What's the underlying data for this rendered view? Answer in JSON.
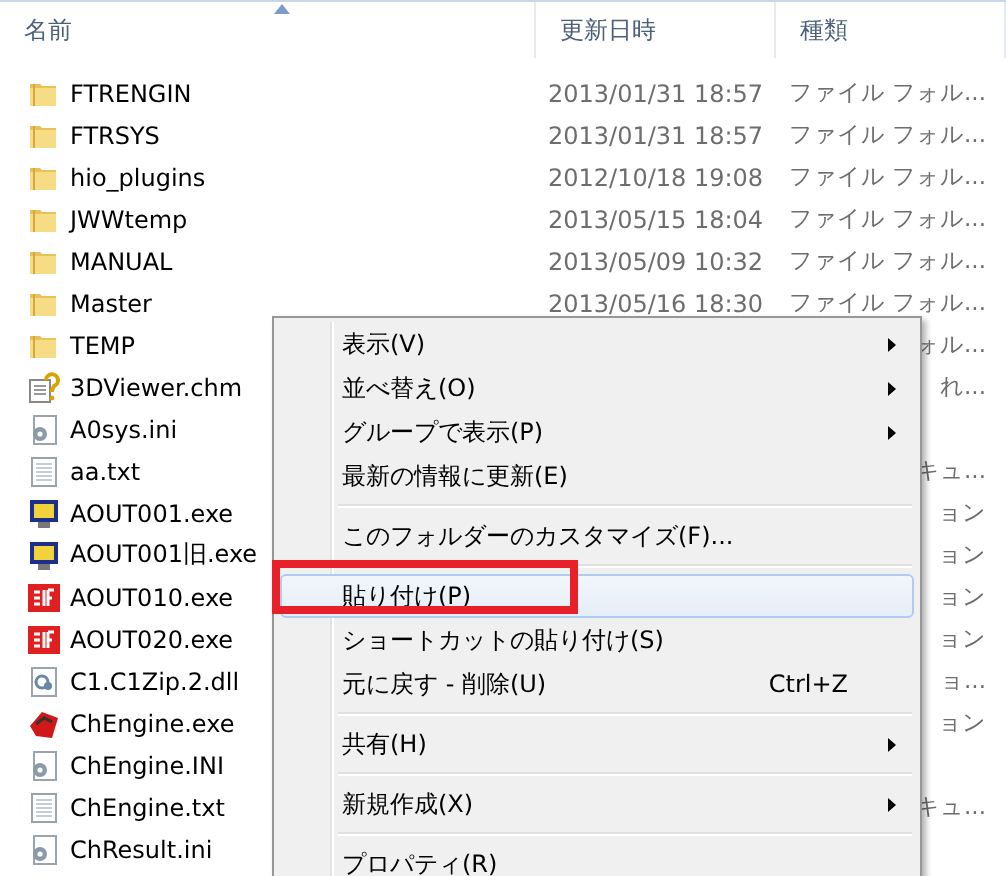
{
  "columns": [
    {
      "label": "名前",
      "sorted": true
    },
    {
      "label": "更新日時",
      "sorted": false
    },
    {
      "label": "種類",
      "sorted": false
    }
  ],
  "files": [
    {
      "name": "FTRENGIN",
      "kind": "folder",
      "date": "2013/01/31 18:57",
      "type": "ファイル フォル..."
    },
    {
      "name": "FTRSYS",
      "kind": "folder",
      "date": "2013/01/31 18:57",
      "type": "ファイル フォル..."
    },
    {
      "name": "hio_plugins",
      "kind": "folder",
      "date": "2012/10/18 19:08",
      "type": "ファイル フォル..."
    },
    {
      "name": "JWWtemp",
      "kind": "folder",
      "date": "2013/05/15 18:04",
      "type": "ファイル フォル..."
    },
    {
      "name": "MANUAL",
      "kind": "folder",
      "date": "2013/05/09 10:32",
      "type": "ファイル フォル..."
    },
    {
      "name": "Master",
      "kind": "folder",
      "date": "2013/05/16 18:30",
      "type": "ファイル フォル..."
    },
    {
      "name": "TEMP",
      "kind": "folder",
      "type": "ォル..."
    },
    {
      "name": "3DViewer.chm",
      "kind": "help",
      "type": "れ..."
    },
    {
      "name": "A0sys.ini",
      "kind": "settings"
    },
    {
      "name": "aa.txt",
      "kind": "text",
      "type": "キュ..."
    },
    {
      "name": "AOUT001.exe",
      "kind": "app",
      "type": "ョン"
    },
    {
      "name": "AOUT001旧.exe",
      "kind": "app",
      "type": "ョン"
    },
    {
      "name": "AOUT010.exe",
      "kind": "sif",
      "type": "ョン"
    },
    {
      "name": "AOUT020.exe",
      "kind": "sif",
      "type": "ョン"
    },
    {
      "name": "C1.C1Zip.2.dll",
      "kind": "library",
      "type": "ョ..."
    },
    {
      "name": "ChEngine.exe",
      "kind": "engine",
      "type": "ョン"
    },
    {
      "name": "ChEngine.INI",
      "kind": "settings"
    },
    {
      "name": "ChEngine.txt",
      "kind": "text",
      "type": "キュ..."
    },
    {
      "name": "ChResult.ini",
      "kind": "settings"
    }
  ],
  "context_menu": [
    {
      "kind": "item",
      "label": "表示(V)",
      "submenu": true,
      "selected": false
    },
    {
      "kind": "item",
      "label": "並べ替え(O)",
      "submenu": true,
      "selected": false
    },
    {
      "kind": "item",
      "label": "グループで表示(P)",
      "submenu": true,
      "selected": false
    },
    {
      "kind": "item",
      "label": "最新の情報に更新(E)",
      "submenu": false,
      "selected": false
    },
    {
      "kind": "separator"
    },
    {
      "kind": "item",
      "label": "このフォルダーのカスタマイズ(F)...",
      "submenu": false,
      "selected": false
    },
    {
      "kind": "separator"
    },
    {
      "kind": "item",
      "label": "貼り付け(P)",
      "submenu": false,
      "selected": true,
      "marked": true
    },
    {
      "kind": "item",
      "label": "ショートカットの貼り付け(S)",
      "submenu": false,
      "selected": false
    },
    {
      "kind": "item",
      "label": "元に戻す - 削除(U)",
      "shortcut": "Ctrl+Z",
      "submenu": false,
      "selected": false
    },
    {
      "kind": "separator"
    },
    {
      "kind": "item",
      "label": "共有(H)",
      "submenu": true,
      "selected": false
    },
    {
      "kind": "separator"
    },
    {
      "kind": "item",
      "label": "新規作成(X)",
      "submenu": true,
      "selected": false
    },
    {
      "kind": "separator"
    },
    {
      "kind": "item",
      "label": "プロパティ(R)",
      "submenu": false,
      "selected": false
    }
  ]
}
